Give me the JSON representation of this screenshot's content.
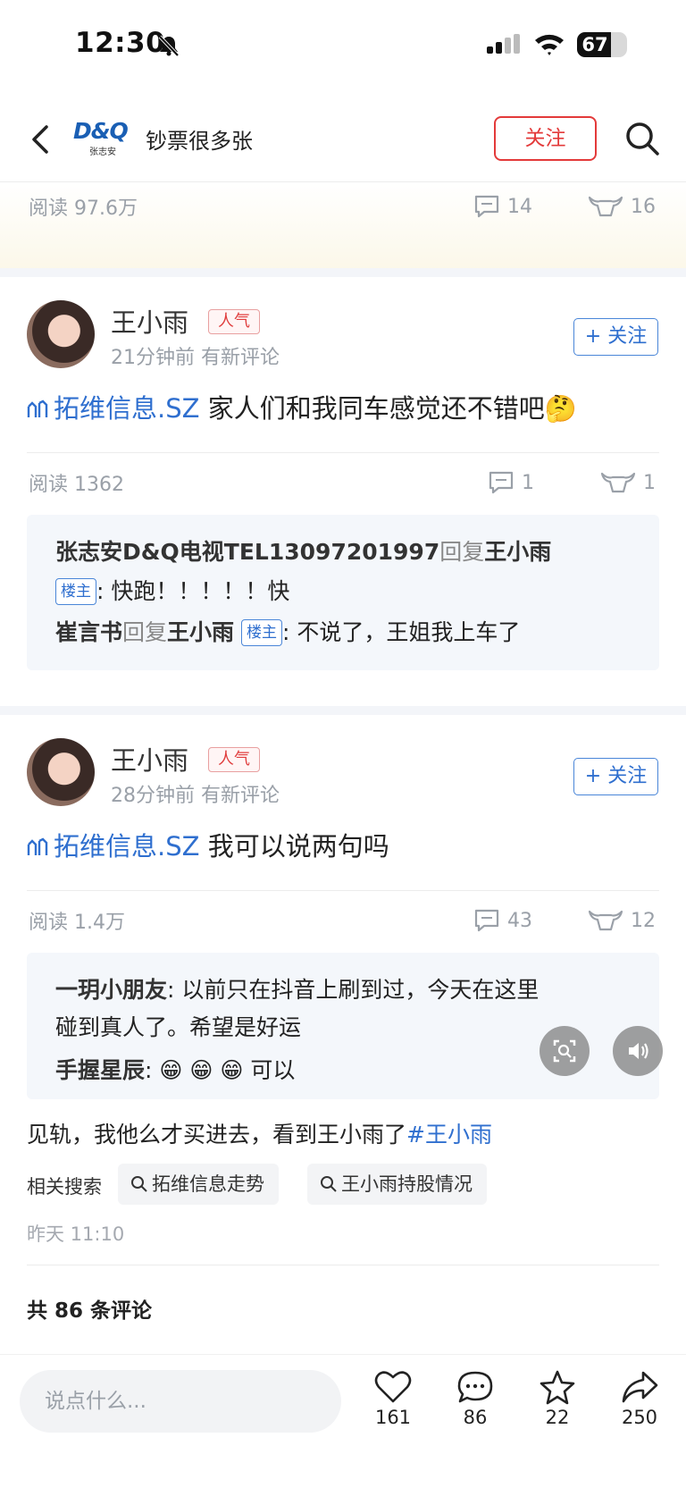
{
  "status": {
    "time": "12:30",
    "battery": "67",
    "battery_level": 0.67
  },
  "nav": {
    "brand": "D&Q",
    "brand_sub": "张志安",
    "title": "钞票很多张",
    "follow": "关注"
  },
  "prev_stats": {
    "read": "阅读 97.6万",
    "comments": "14",
    "likes": "16"
  },
  "posts": [
    {
      "author": "王小雨",
      "badge": "人气",
      "meta": "21分钟前 有新评论",
      "follow": "+ 关注",
      "stock": "拓维信息.SZ",
      "content": "家人们和我同车感觉还不错吧🤔",
      "read": "阅读 1362",
      "comments": "1",
      "likes": "1",
      "replies": [
        {
          "user": "张志安D&Q电视TEL13097201997",
          "verb": "回复",
          "target": "王小雨",
          "owner_badge": "楼主",
          "text": ": 快跑！！！！！快"
        },
        {
          "user": "崔言书",
          "verb": "回复",
          "target": "王小雨",
          "owner_badge": "楼主",
          "text": ": 不说了，王姐我上车了"
        }
      ]
    },
    {
      "author": "王小雨",
      "badge": "人气",
      "meta": "28分钟前 有新评论",
      "follow": "+ 关注",
      "stock": "拓维信息.SZ",
      "content": "我可以说两句吗",
      "read": "阅读 1.4万",
      "comments": "43",
      "likes": "12",
      "replies": [
        {
          "user": "一玥小朋友",
          "text_line1": ": 以前只在抖音上刷到过，今天在这里",
          "text_line2": "碰到真人了。希望是好运"
        },
        {
          "user": "手握星辰",
          "emojis": "😁 😁 😁",
          "text": " 可以"
        }
      ]
    }
  ],
  "body": {
    "text": "见轨，我他么才买进去，看到王小雨了",
    "hashtag": "#王小雨"
  },
  "related": {
    "label": "相关搜索",
    "chips": [
      "拓维信息走势",
      "王小雨持股情况"
    ]
  },
  "post_time": "昨天 11:10",
  "comment_total": "共 86 条评论",
  "bottom_bar": {
    "placeholder": "说点什么...",
    "likes": "161",
    "comments": "86",
    "favorites": "22",
    "shares": "250"
  }
}
